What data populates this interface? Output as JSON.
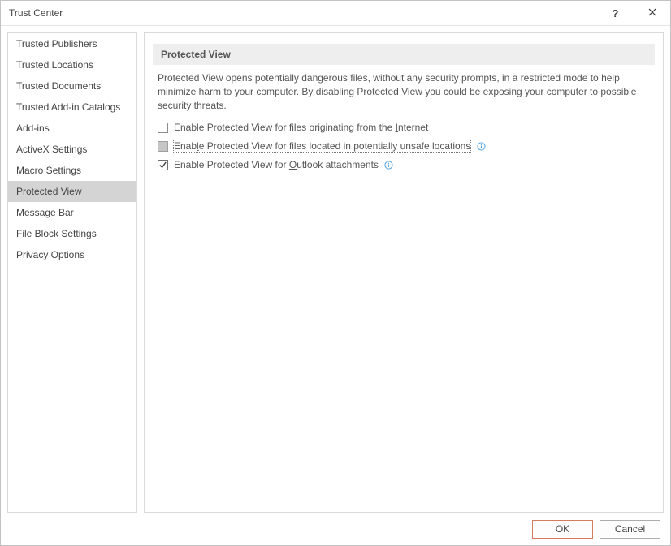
{
  "window": {
    "title": "Trust Center",
    "help_label": "?",
    "close_label": "Close"
  },
  "sidebar": {
    "items": [
      {
        "id": "trusted-publishers",
        "label": "Trusted Publishers"
      },
      {
        "id": "trusted-locations",
        "label": "Trusted Locations"
      },
      {
        "id": "trusted-documents",
        "label": "Trusted Documents"
      },
      {
        "id": "trusted-addin-cats",
        "label": "Trusted Add-in Catalogs"
      },
      {
        "id": "add-ins",
        "label": "Add-ins"
      },
      {
        "id": "activex-settings",
        "label": "ActiveX Settings"
      },
      {
        "id": "macro-settings",
        "label": "Macro Settings"
      },
      {
        "id": "protected-view",
        "label": "Protected View",
        "selected": true
      },
      {
        "id": "message-bar",
        "label": "Message Bar"
      },
      {
        "id": "file-block-settings",
        "label": "File Block Settings"
      },
      {
        "id": "privacy-options",
        "label": "Privacy Options"
      }
    ]
  },
  "main": {
    "section_title": "Protected View",
    "description": "Protected View opens potentially dangerous files, without any security prompts, in a restricted mode to help minimize harm to your computer. By disabling Protected View you could be exposing your computer to possible security threats.",
    "options": [
      {
        "id": "from-internet",
        "label": "Enable Protected View for files originating from the Internet",
        "underline": "I",
        "checked": false,
        "has_info": false
      },
      {
        "id": "unsafe-locations",
        "label": "Enable Protected View for files located in potentially unsafe locations",
        "underline": "l",
        "checked": false,
        "greyed": true,
        "has_info": true,
        "focused": true
      },
      {
        "id": "outlook-attach",
        "label": "Enable Protected View for Outlook attachments",
        "underline": "O",
        "checked": true,
        "has_info": true
      }
    ]
  },
  "footer": {
    "ok_label": "OK",
    "cancel_label": "Cancel"
  }
}
